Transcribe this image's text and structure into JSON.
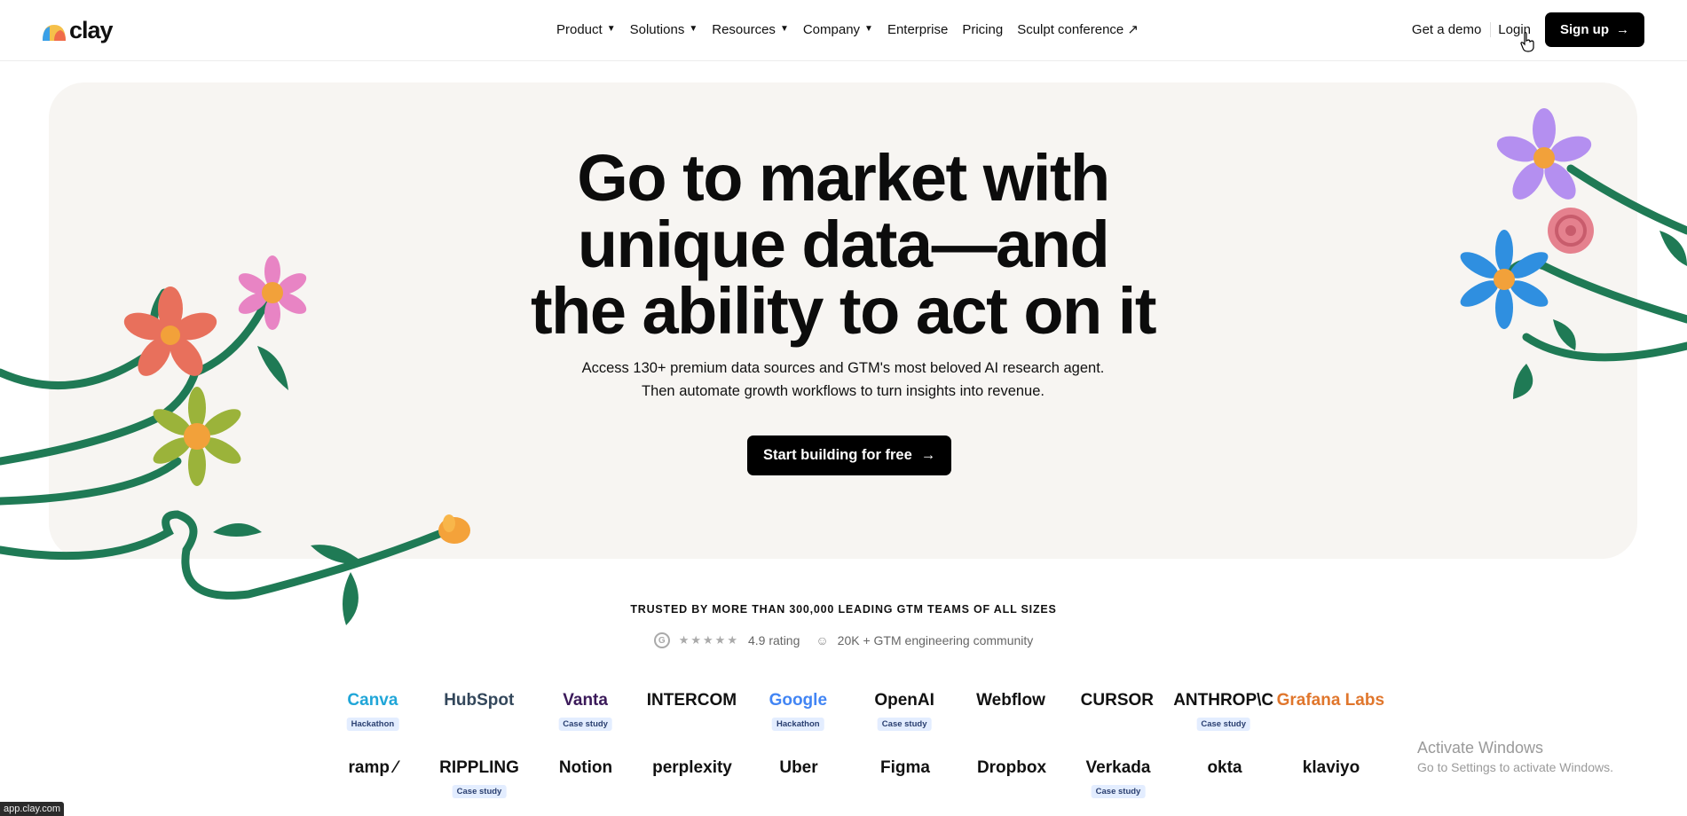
{
  "nav": {
    "logo_text": "clay",
    "links": [
      {
        "label": "Product",
        "dropdown": true
      },
      {
        "label": "Solutions",
        "dropdown": true
      },
      {
        "label": "Resources",
        "dropdown": true
      },
      {
        "label": "Company",
        "dropdown": true
      },
      {
        "label": "Enterprise",
        "dropdown": false
      },
      {
        "label": "Pricing",
        "dropdown": false
      },
      {
        "label": "Sculpt conference ↗",
        "dropdown": false
      }
    ],
    "get_demo": "Get a demo",
    "login": "Login",
    "signup": "Sign up"
  },
  "hero": {
    "title_line1": "Go to market with",
    "title_line2": "unique data—and",
    "title_line3": "the ability to act on it",
    "sub_line1": "Access 130+ premium data sources and GTM's most beloved AI research agent.",
    "sub_line2": "Then automate growth workflows to turn insights into revenue.",
    "cta": "Start building for free"
  },
  "trust": {
    "heading": "TRUSTED BY MORE THAN 300,000 LEADING GTM TEAMS OF ALL SIZES",
    "g2": "G",
    "stars": "★★★★★",
    "rating": "4.9 rating",
    "community": "20K + GTM engineering community"
  },
  "logos_row1": [
    {
      "name": "Canva",
      "tag": "Hackathon",
      "color": "#20a6d8"
    },
    {
      "name": "HubSpot",
      "tag": "",
      "color": "#33475b"
    },
    {
      "name": "Vanta",
      "tag": "Case study",
      "color": "#3b1a5a"
    },
    {
      "name": "INTERCOM",
      "tag": "",
      "color": "#111111"
    },
    {
      "name": "Google",
      "tag": "Hackathon",
      "color": "#4285f4"
    },
    {
      "name": "OpenAI",
      "tag": "Case study",
      "color": "#111111"
    },
    {
      "name": "Webflow",
      "tag": "",
      "color": "#111111"
    },
    {
      "name": "CURSOR",
      "tag": "",
      "color": "#111111"
    },
    {
      "name": "ANTHROP\\C",
      "tag": "Case study",
      "color": "#111111"
    },
    {
      "name": "Grafana Labs",
      "tag": "",
      "color": "#e0762c"
    }
  ],
  "logos_row2": [
    {
      "name": "ramp ⁄",
      "tag": "",
      "color": "#111111"
    },
    {
      "name": "RIPPLING",
      "tag": "Case study",
      "color": "#111111"
    },
    {
      "name": "Notion",
      "tag": "",
      "color": "#111111"
    },
    {
      "name": "perplexity",
      "tag": "",
      "color": "#111111"
    },
    {
      "name": "Uber",
      "tag": "",
      "color": "#111111"
    },
    {
      "name": "Figma",
      "tag": "",
      "color": "#111111"
    },
    {
      "name": "Dropbox",
      "tag": "",
      "color": "#111111"
    },
    {
      "name": "Verkada",
      "tag": "Case study",
      "color": "#111111"
    },
    {
      "name": "okta",
      "tag": "",
      "color": "#111111"
    },
    {
      "name": "klaviyo",
      "tag": "",
      "color": "#111111"
    }
  ],
  "status_url": "app.clay.com",
  "windows": {
    "line1": "Activate Windows",
    "line2": "Go to Settings to activate Windows."
  },
  "colors": {
    "hero_bg": "#f7f5f2",
    "button_bg": "#000000",
    "stem": "#1f7a55"
  }
}
